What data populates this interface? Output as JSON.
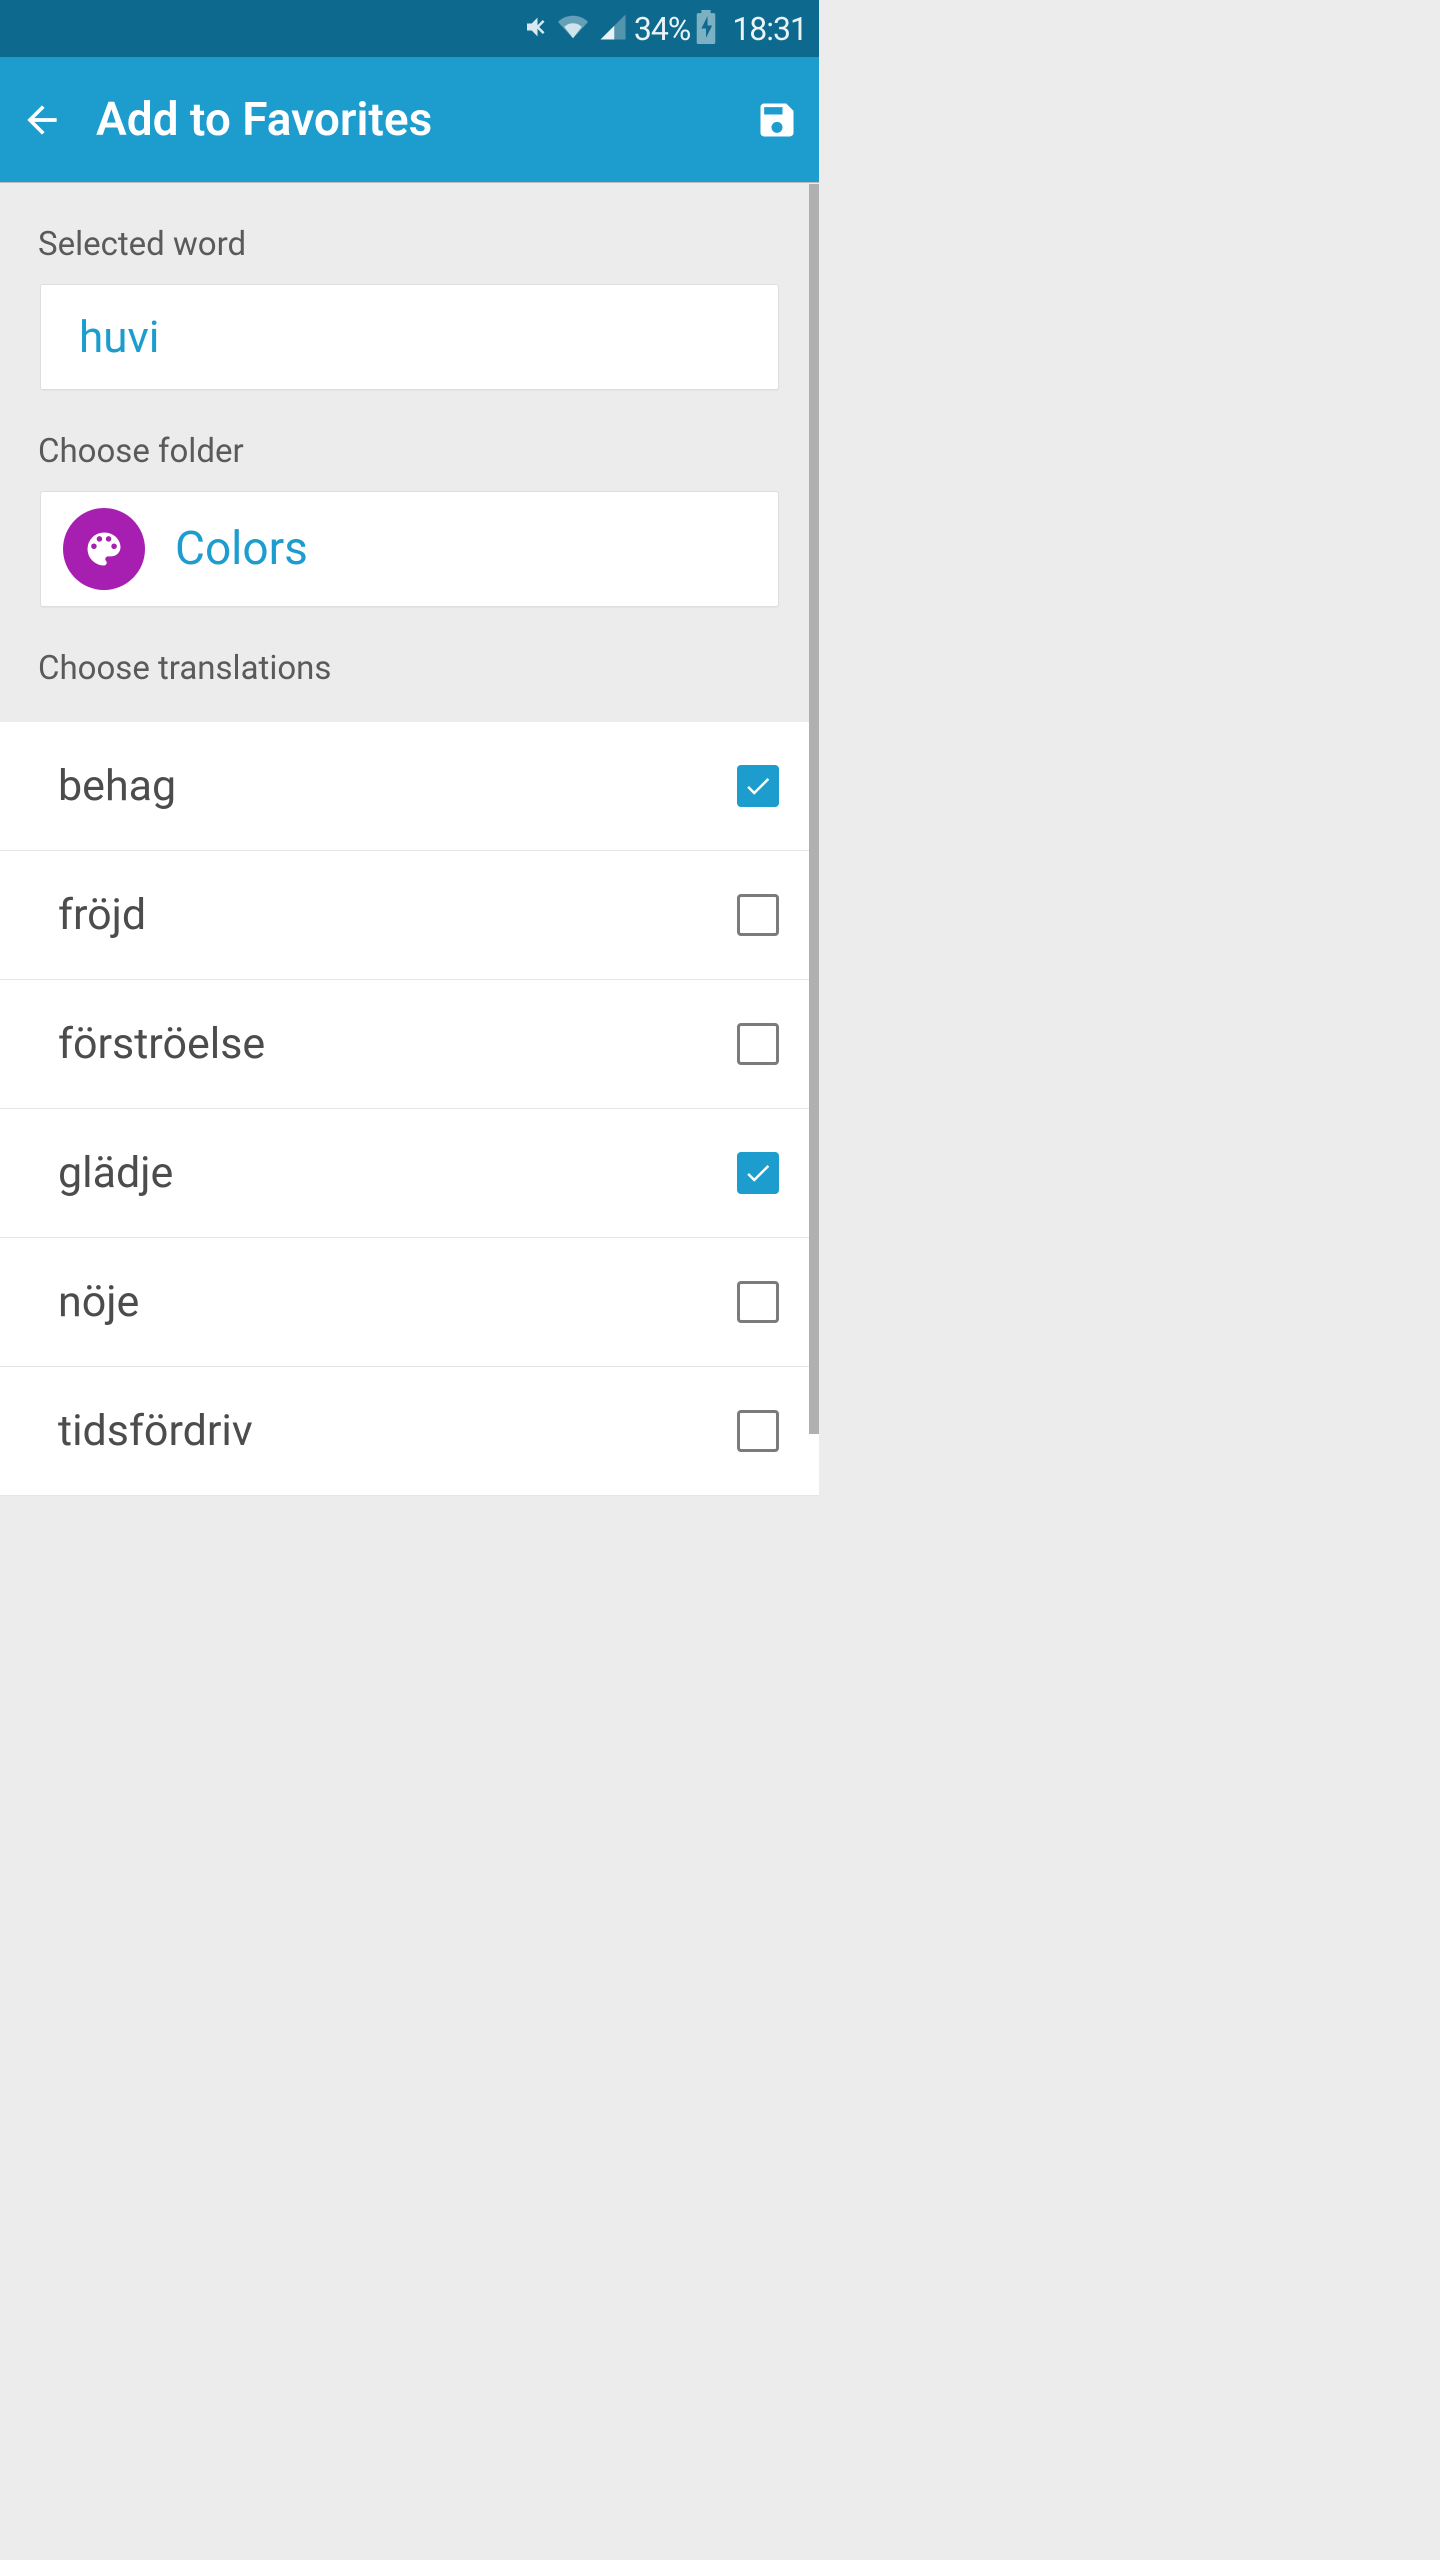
{
  "status": {
    "battery_pct": "34%",
    "time": "18:31"
  },
  "appbar": {
    "title": "Add to Favorites"
  },
  "sections": {
    "selected_word_label": "Selected word",
    "selected_word_value": "huvi",
    "choose_folder_label": "Choose folder",
    "folder_name": "Colors",
    "choose_translations_label": "Choose translations"
  },
  "translations": [
    {
      "label": "behag",
      "checked": true
    },
    {
      "label": "fröjd",
      "checked": false
    },
    {
      "label": "förströelse",
      "checked": false
    },
    {
      "label": "glädje",
      "checked": true
    },
    {
      "label": "nöje",
      "checked": false
    },
    {
      "label": "tidsfördriv",
      "checked": false
    }
  ]
}
